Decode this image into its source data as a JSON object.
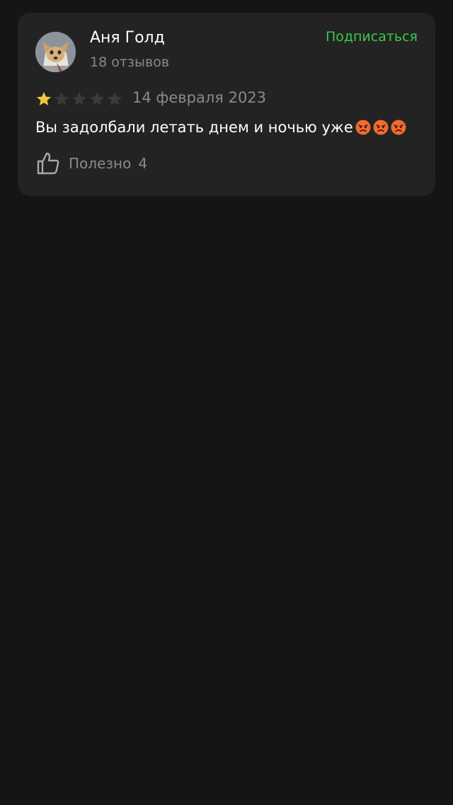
{
  "review": {
    "author": {
      "name": "Аня Голд",
      "reviews_count": "18 отзывов",
      "avatar_icon": "user-avatar-cartoon-dog"
    },
    "subscribe_label": "Подписаться",
    "rating": 1,
    "max_rating": 5,
    "date": "14 февраля 2023",
    "text": "Вы задолбали летать днем и ночью уже",
    "emojis": [
      "angry-face-emoji",
      "angry-face-emoji",
      "angry-face-emoji"
    ],
    "helpful": {
      "label": "Полезно",
      "count": "4",
      "icon": "thumbs-up-icon"
    }
  },
  "colors": {
    "background": "#151515",
    "card": "#232323",
    "accent": "#3bc84f",
    "star_filled": "#f5c542",
    "star_empty": "#3a3a3a",
    "muted_text": "#8a8a8a"
  }
}
